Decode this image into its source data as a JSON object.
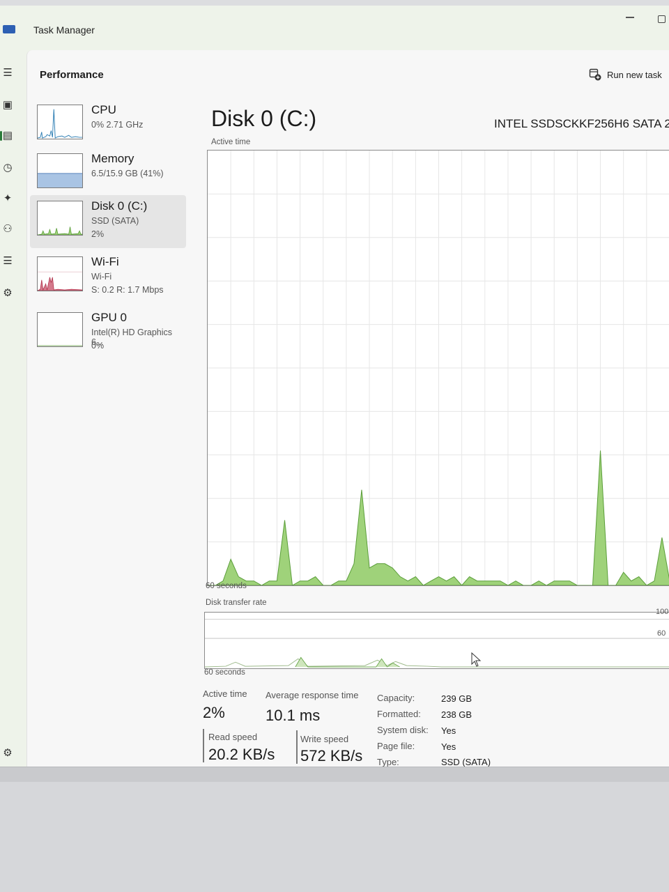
{
  "window": {
    "title": "Task Manager"
  },
  "header": {
    "title": "Performance",
    "run_new_task": "Run new task"
  },
  "sidebar": {
    "items": [
      {
        "name": "CPU",
        "sub": "0%  2.71 GHz",
        "sub2": ""
      },
      {
        "name": "Memory",
        "sub": "6.5/15.9 GB (41%)",
        "sub2": ""
      },
      {
        "name": "Disk 0 (C:)",
        "sub": "SSD (SATA)",
        "sub2": "2%"
      },
      {
        "name": "Wi-Fi",
        "sub": "Wi-Fi",
        "sub2": "S: 0.2  R: 1.7 Mbps"
      },
      {
        "name": "GPU 0",
        "sub": "Intel(R) HD Graphics 6...",
        "sub2": "0%"
      }
    ]
  },
  "detail": {
    "title": "Disk 0 (C:)",
    "model": "INTEL SSDSCKKF256H6 SATA 2",
    "active_time_label": "Active time",
    "seconds_label_1": "60 seconds",
    "transfer_label": "Disk transfer rate",
    "seconds_label_2": "60 seconds",
    "rate_mark_top": "100",
    "rate_mark_mid": "60"
  },
  "stats": {
    "active_time_label": "Active time",
    "active_time_value": "2%",
    "avg_response_label": "Average response time",
    "avg_response_value": "10.1 ms",
    "read_speed_label": "Read speed",
    "read_speed_value": "20.2 KB/s",
    "write_speed_label": "Write speed",
    "write_speed_value": "572 KB/s",
    "props": [
      {
        "label": "Capacity:",
        "value": "239 GB"
      },
      {
        "label": "Formatted:",
        "value": "238 GB"
      },
      {
        "label": "System disk:",
        "value": "Yes"
      },
      {
        "label": "Page file:",
        "value": "Yes"
      },
      {
        "label": "Type:",
        "value": "SSD (SATA)"
      }
    ]
  },
  "colors": {
    "disk_fill": "#9fd27a",
    "disk_line": "#5b9e3a",
    "memory_fill": "#a9c4e4",
    "wifi_line": "#b0304a",
    "cpu_line": "#2f7fb4",
    "grid": "#e6e6e6"
  },
  "chart_data": {
    "type": "area",
    "title": "Active time",
    "xlabel": "60 seconds",
    "ylabel": "",
    "xlim": [
      0,
      60
    ],
    "ylim": [
      0,
      100
    ],
    "x": [
      0,
      1,
      2,
      3,
      4,
      5,
      6,
      7,
      8,
      9,
      10,
      11,
      12,
      13,
      14,
      15,
      16,
      17,
      18,
      19,
      20,
      21,
      22,
      23,
      24,
      25,
      26,
      27,
      28,
      29,
      30,
      31,
      32,
      33,
      34,
      35,
      36,
      37,
      38,
      39,
      40,
      41,
      42,
      43,
      44,
      45,
      46,
      47,
      48,
      49,
      50,
      51,
      52,
      53,
      54,
      55,
      56,
      57,
      58,
      59,
      60
    ],
    "series": [
      {
        "values": [
          0,
          0,
          1,
          6,
          2,
          1,
          1,
          0,
          1,
          1,
          15,
          0,
          1,
          1,
          2,
          0,
          0,
          1,
          1,
          5,
          22,
          4,
          5,
          5,
          4,
          2,
          1,
          2,
          0,
          1,
          2,
          1,
          2,
          0,
          2,
          1,
          1,
          1,
          1,
          0,
          1,
          0,
          0,
          1,
          0,
          1,
          1,
          1,
          0,
          0,
          0,
          31,
          0,
          0,
          3,
          1,
          2,
          0,
          1,
          11,
          1
        ]
      }
    ]
  }
}
